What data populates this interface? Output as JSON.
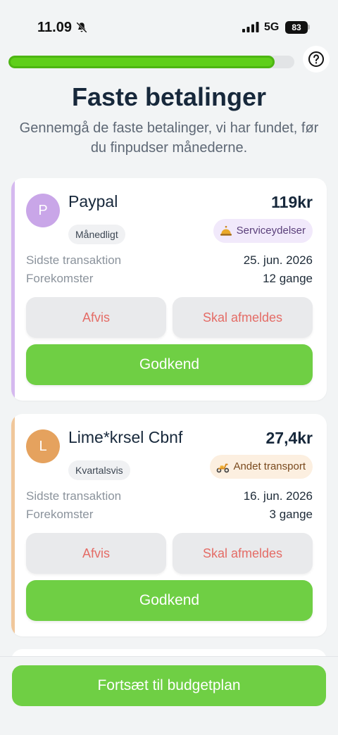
{
  "status_bar": {
    "time": "11.09",
    "network": "5G",
    "battery": "83"
  },
  "progress": {
    "value": 0.93
  },
  "header": {
    "title": "Faste betalinger",
    "subtitle": "Gennemgå de faste betalinger, vi har fundet, før du finpudser månederne."
  },
  "colors": {
    "accent_green": "#6fcf44",
    "reject_text": "#e46c66"
  },
  "cards": [
    {
      "initial": "P",
      "avatar_color": "#c9a6e8",
      "stripe_color": "#d5b9ef",
      "merchant": "Paypal",
      "amount": "119kr",
      "frequency": "Månedligt",
      "category": "Serviceydelser",
      "category_icon": "bell-icon",
      "category_bg": "#f1e9fb",
      "category_fg": "#5a3f7a",
      "last_transaction_label": "Sidste transaktion",
      "last_transaction": "25. jun. 2026",
      "occurrences_label": "Forekomster",
      "occurrences": "12 gange",
      "reject_label": "Afvis",
      "unsubscribe_label": "Skal afmeldes",
      "approve_label": "Godkend"
    },
    {
      "initial": "L",
      "avatar_color": "#e5a25e",
      "stripe_color": "#f0c79b",
      "merchant": "Lime*krsel Cbnf",
      "amount": "27,4kr",
      "frequency": "Kvartalsvis",
      "category": "Andet transport",
      "category_icon": "scooter-icon",
      "category_bg": "#fcefe0",
      "category_fg": "#7a4a1e",
      "last_transaction_label": "Sidste transaktion",
      "last_transaction": "16. jun. 2026",
      "occurrences_label": "Forekomster",
      "occurrences": "3 gange",
      "reject_label": "Afvis",
      "unsubscribe_label": "Skal afmeldes",
      "approve_label": "Godkend"
    }
  ],
  "footer": {
    "continue_label": "Fortsæt til budgetplan"
  }
}
